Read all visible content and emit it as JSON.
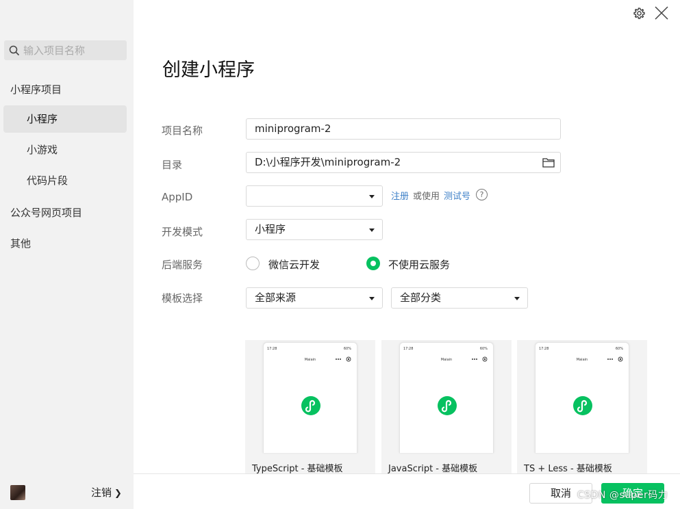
{
  "sidebar": {
    "search_placeholder": "输入项目名称",
    "group_miniprogram": "小程序项目",
    "items": [
      {
        "label": "小程序",
        "active": true
      },
      {
        "label": "小游戏",
        "active": false
      },
      {
        "label": "代码片段",
        "active": false
      }
    ],
    "group_official": "公众号网页项目",
    "group_other": "其他",
    "logout_label": "注销"
  },
  "header": {
    "title": "创建小程序"
  },
  "form": {
    "project_name": {
      "label": "项目名称",
      "value": "miniprogram-2"
    },
    "directory": {
      "label": "目录",
      "value": "D:\\小程序开发\\miniprogram-2"
    },
    "appid": {
      "label": "AppID",
      "value": "",
      "register_link": "注册",
      "or_use_text": "或使用",
      "test_link": "测试号",
      "help": "?"
    },
    "dev_mode": {
      "label": "开发模式",
      "value": "小程序"
    },
    "backend": {
      "label": "后端服务",
      "options": [
        {
          "label": "微信云开发",
          "selected": false
        },
        {
          "label": "不使用云服务",
          "selected": true
        }
      ]
    },
    "template": {
      "label": "模板选择",
      "source_value": "全部来源",
      "category_value": "全部分类"
    }
  },
  "templates": [
    {
      "name": "TypeScript - 基础模板",
      "time": "17:28",
      "battery": "60%",
      "page_title": "Maiain"
    },
    {
      "name": "JavaScript - 基础模板",
      "time": "17:28",
      "battery": "60%",
      "page_title": "Maiain"
    },
    {
      "name": "TS + Less - 基础模板",
      "time": "17:28",
      "battery": "60%",
      "page_title": "Maiain"
    }
  ],
  "footer": {
    "cancel_label": "取消",
    "confirm_label": "确定",
    "watermark": "CSDN @super码力"
  },
  "colors": {
    "accent": "#07c160",
    "link": "#3c7fc7",
    "sidebar_bg": "#f2f2f2"
  }
}
